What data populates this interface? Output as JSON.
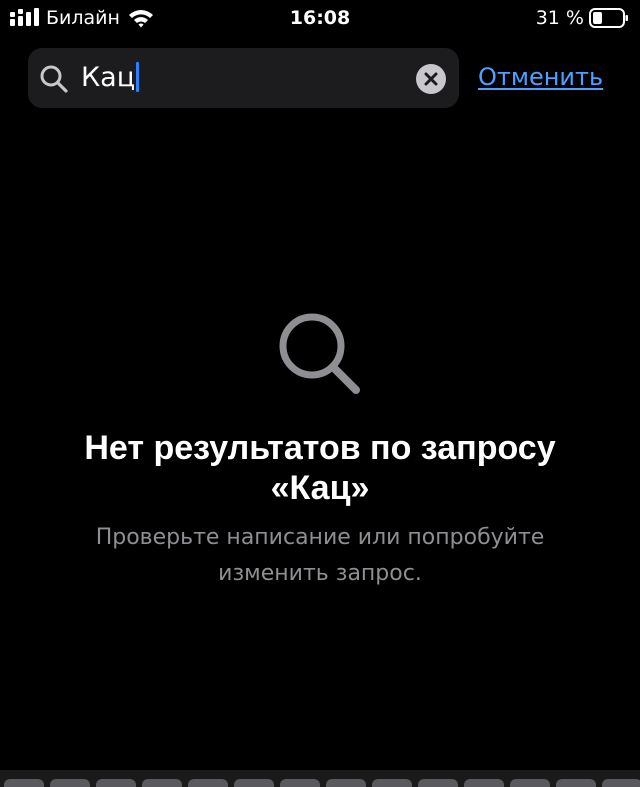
{
  "status_bar": {
    "carrier": "Билайн",
    "time": "16:08",
    "battery_percent": "31 %",
    "battery_level": 0.31
  },
  "search": {
    "query": "Кац",
    "cancel_label": "Отменить"
  },
  "empty_state": {
    "title_line1": "Нет результатов по запросу",
    "title_line2": "«Кац»",
    "subtitle_line1": "Проверьте написание или попробуйте",
    "subtitle_line2": "изменить запрос."
  },
  "colors": {
    "background": "#000000",
    "search_field": "#1c1c1e",
    "accent": "#4da0ff",
    "secondary_text": "#8e8e93",
    "caret": "#2b82ff"
  },
  "icons": {
    "signal": "cellular-signal-icon",
    "wifi": "wifi-icon",
    "battery": "battery-icon",
    "search": "magnifying-glass-icon",
    "clear": "clear-x-circle-icon",
    "empty": "magnifying-glass-icon"
  }
}
